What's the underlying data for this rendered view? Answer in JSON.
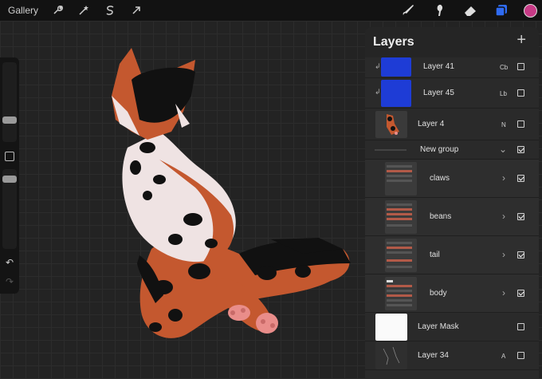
{
  "topbar": {
    "gallery_label": "Gallery",
    "left_tools": [
      "wrench-icon",
      "magic-wand-icon",
      "selection-s-icon",
      "move-arrow-icon"
    ],
    "right_tools": [
      "brush-icon",
      "smudge-icon",
      "eraser-icon",
      "layers-icon"
    ],
    "color_accent": "#c73a86",
    "layers_active_color": "#2f6bf2"
  },
  "layers_panel": {
    "title": "Layers",
    "add_button": "+",
    "rows": [
      {
        "name": "Layer 41",
        "mode": "Cb",
        "visible": false,
        "clipped": true
      },
      {
        "name": "Layer 45",
        "mode": "Lb",
        "visible": false,
        "clipped": true
      },
      {
        "name": "Layer 4",
        "mode": "N",
        "visible": false
      },
      {
        "name": "New group",
        "visible": true,
        "expanded": true
      },
      {
        "name": "claws",
        "visible": true
      },
      {
        "name": "beans",
        "visible": true
      },
      {
        "name": "tail",
        "visible": true
      },
      {
        "name": "body",
        "visible": true
      },
      {
        "name": "Layer Mask",
        "visible": false
      },
      {
        "name": "Layer 34",
        "mode": "A",
        "visible": false
      }
    ]
  },
  "sidebar": {
    "undo_icon": "undo-icon",
    "redo_icon": "redo-icon"
  },
  "colors": {
    "fur_orange": "#c4582f",
    "fur_white": "#efe3e3",
    "fur_black": "#111111",
    "paw_pink": "#e98d8a"
  }
}
